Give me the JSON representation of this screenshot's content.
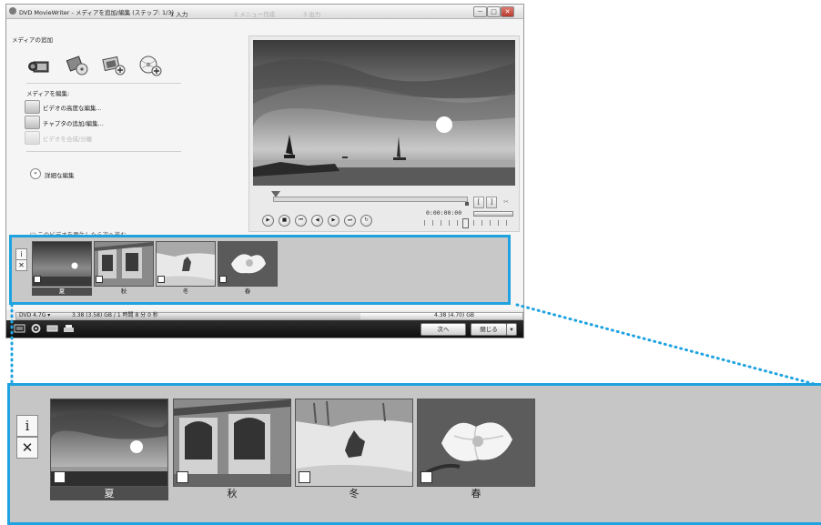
{
  "window": {
    "title": "DVD MovieWriter - メディアを追加/編集 (ステップ: 1/3)",
    "controls": [
      "－",
      "□",
      "✕"
    ]
  },
  "steps": [
    {
      "label": "1 入力",
      "active": true
    },
    {
      "label": "2 メニュー作成",
      "active": false
    },
    {
      "label": "3 出力",
      "active": false
    }
  ],
  "left_panel": {
    "add_media_heading": "メディアの追加",
    "tool_icons": [
      "camcorder-icon",
      "disc-import-icon",
      "photo-add-icon",
      "disc-add-icon"
    ],
    "edit_media_heading": "メディアを編集:",
    "edit_items": [
      {
        "label": "ビデオの高度な編集...",
        "enabled": true
      },
      {
        "label": "チャプタの追加/編集...",
        "enabled": true
      },
      {
        "label": "ビデオを合成/分離",
        "enabled": false
      }
    ],
    "advanced_edit": "詳細な編集",
    "cut_line_text": "□ このビデオを再生したら次へ進む"
  },
  "player": {
    "timecode": "0:00:00:00"
  },
  "clips": [
    {
      "caption": "夏",
      "selected": true
    },
    {
      "caption": "秋",
      "selected": false
    },
    {
      "caption": "冬",
      "selected": false
    },
    {
      "caption": "春",
      "selected": false
    }
  ],
  "strip_buttons": {
    "info": "i",
    "delete": "✕"
  },
  "bottom": {
    "disc_type": "DVD 4.7G",
    "capacity_used": "3.38 (3.58) GB / 1 時間 8 分 0 秒",
    "capacity_total": "4.38 (4.70) GB",
    "capacity_fraction": 0.68,
    "next_label": "次へ",
    "close_label": "閉じる"
  }
}
